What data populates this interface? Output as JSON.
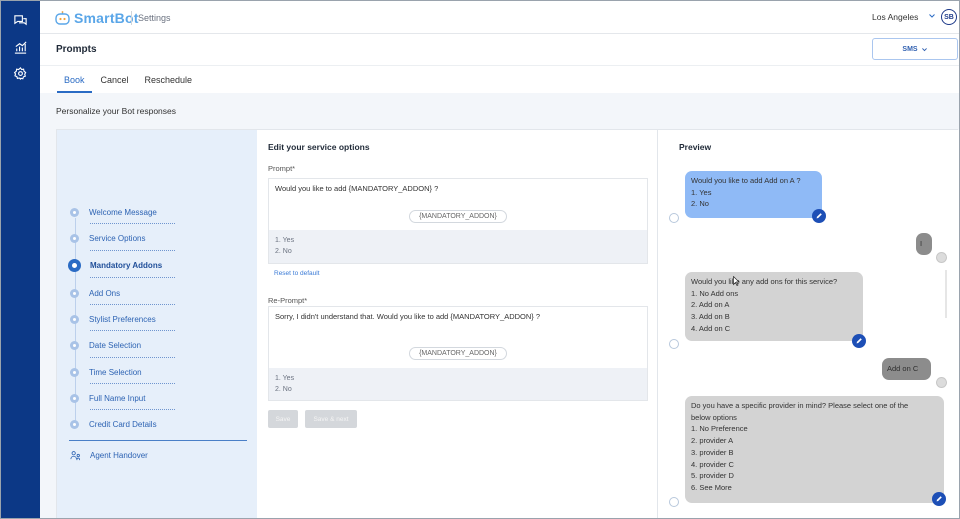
{
  "brand": {
    "name": "SmartBot",
    "accent": "#5aa6e8"
  },
  "topbar": {
    "breadcrumb": "Settings",
    "timezone": "Los Angeles",
    "user_initials": "SB"
  },
  "nav_icons": [
    "chat-icon",
    "analytics-icon",
    "settings-gear-icon"
  ],
  "page": {
    "title": "Prompts",
    "channel_select": "SMS"
  },
  "tabs": [
    {
      "label": "Book",
      "active": true
    },
    {
      "label": "Cancel",
      "active": false
    },
    {
      "label": "Reschedule",
      "active": false
    }
  ],
  "subtitle": "Personalize your Bot responses",
  "steps": [
    {
      "label": "Welcome Message"
    },
    {
      "label": "Service Options"
    },
    {
      "label": "Mandatory Addons",
      "active": true
    },
    {
      "label": "Add Ons"
    },
    {
      "label": "Stylist Preferences"
    },
    {
      "label": "Date Selection"
    },
    {
      "label": "Time Selection"
    },
    {
      "label": "Full Name Input"
    },
    {
      "label": "Credit Card Details"
    }
  ],
  "handover": "Agent Handover",
  "editor": {
    "title": "Edit your service options",
    "prompt_label": "Prompt*",
    "prompt_text": "Would you like to add {MANDATORY_ADDON} ?",
    "prompt_chip": "{MANDATORY_ADDON}",
    "prompt_options": [
      "1. Yes",
      "2. No"
    ],
    "reset_label": "Reset to default",
    "reprompt_label": "Re-Prompt*",
    "reprompt_text": "Sorry, I didn't understand that. Would you like to add {MANDATORY_ADDON} ?",
    "reprompt_chip": "{MANDATORY_ADDON}",
    "reprompt_options": [
      "1. Yes",
      "2. No"
    ],
    "save_label": "Save",
    "save_next_label": "Save & next"
  },
  "preview": {
    "title": "Preview",
    "messages": [
      {
        "from": "bot",
        "lines": [
          "Would you like to add Add on A ?",
          "1. Yes",
          "2. No"
        ]
      },
      {
        "from": "user",
        "text": "I"
      },
      {
        "from": "bot",
        "lines": [
          "Would you like any add ons for this service?",
          "1. No Add ons",
          "2. Add on A",
          "3. Add on B",
          "4. Add on C"
        ]
      },
      {
        "from": "user",
        "text": "Add on C"
      },
      {
        "from": "bot",
        "lines": [
          "Do you have a specific provider in mind? Please select one of the",
          "below options",
          "1. No Preference",
          "2. provider A",
          "3. provider B",
          "4. provider C",
          "5. provider D",
          "6. See More"
        ]
      }
    ]
  }
}
